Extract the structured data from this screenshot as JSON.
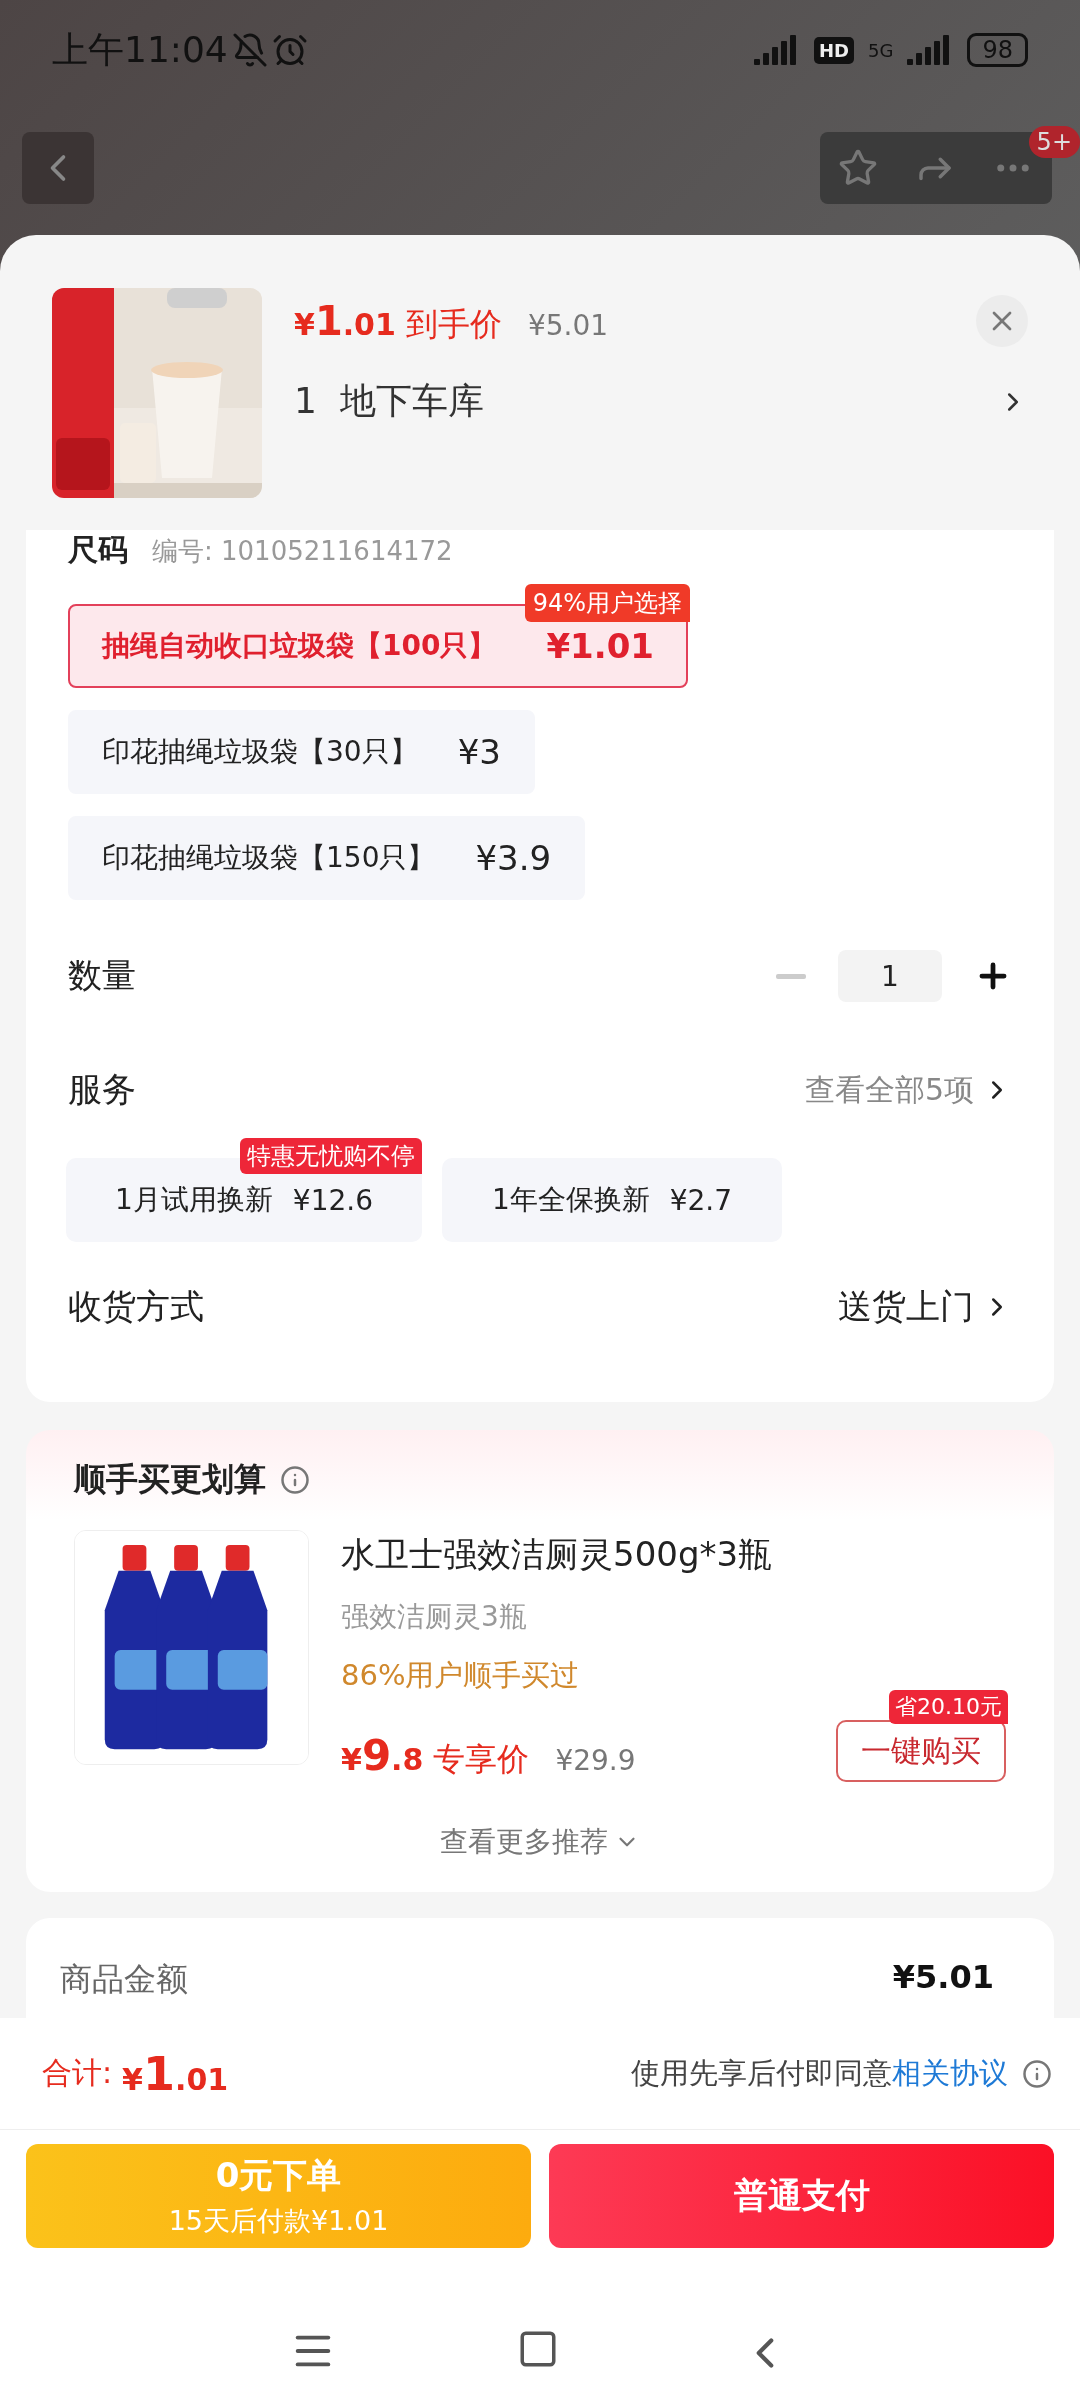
{
  "status_bar": {
    "time": "上午11:04",
    "hd": "HD",
    "network": "5G",
    "battery": "98"
  },
  "nav": {
    "cart_badge": "5+"
  },
  "product": {
    "currency": "¥",
    "price_int": "1",
    "price_dec": ".01",
    "price_label": "到手价",
    "original_price": "¥5.01",
    "address_index": "1",
    "address": "地下车库"
  },
  "size_section": {
    "title": "尺码",
    "code": "编号: 10105211614172"
  },
  "options": [
    {
      "name": "抽绳自动收口垃圾袋【100只】",
      "price": "¥1.01",
      "selected": true,
      "badge": "94%用户选择"
    },
    {
      "name": "印花抽绳垃圾袋【30只】",
      "price": "¥3",
      "selected": false
    },
    {
      "name": "印花抽绳垃圾袋【150只】",
      "price": "¥3.9",
      "selected": false
    }
  ],
  "quantity": {
    "label": "数量",
    "value": "1",
    "minus_disabled": true
  },
  "service": {
    "label": "服务",
    "link": "查看全部5项",
    "options": [
      {
        "name": "1月试用换新",
        "price": "¥12.6",
        "badge": "特惠无忧购不停"
      },
      {
        "name": "1年全保换新",
        "price": "¥2.7"
      }
    ]
  },
  "delivery": {
    "label": "收货方式",
    "value": "送货上门"
  },
  "addon": {
    "title": "顺手买更划算",
    "name": "水卫士强效洁厕灵500g*3瓶",
    "subtitle": "强效洁厕灵3瓶",
    "social": "86%用户顺手买过",
    "currency": "¥",
    "price_int": "9",
    "price_dec": ".8",
    "price_label": "专享价",
    "original_price": "¥29.9",
    "save_badge": "省20.10元",
    "buy": "一键购买",
    "more": "查看更多推荐"
  },
  "summary": {
    "label": "商品金额",
    "value": "¥5.01"
  },
  "footer": {
    "total_label": "合计:",
    "currency": "¥",
    "total_int": "1",
    "total_dec": ".01",
    "agreement_text": "使用先享后付即同意",
    "agreement_link": "相关协议",
    "later_title": "0元下单",
    "later_sub": "15天后付款¥1.01",
    "pay": "普通支付"
  }
}
